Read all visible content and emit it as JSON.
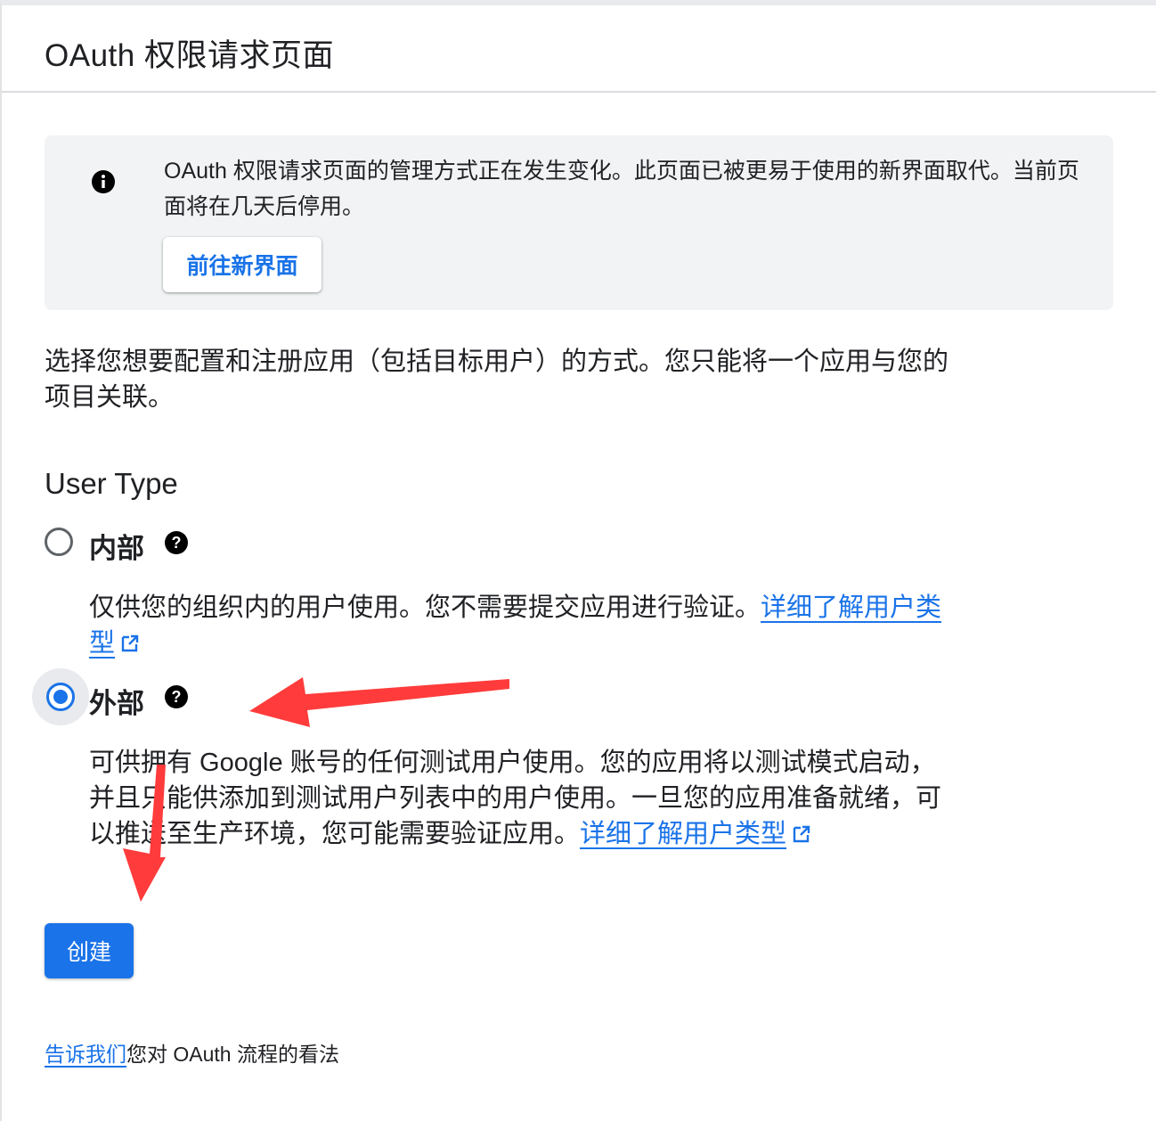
{
  "header": {
    "title": "OAuth 权限请求页面"
  },
  "notice": {
    "icon": "info-icon",
    "text": "OAuth 权限请求页面的管理方式正在发生变化。此页面已被更易于使用的新界面取代。当前页面将在几天后停用。",
    "button_label": "前往新界面"
  },
  "description": "选择您想要配置和注册应用（包括目标用户）的方式。您只能将一个应用与您的项目关联。",
  "user_type": {
    "title": "User Type",
    "internal": {
      "label": "内部",
      "selected": false,
      "description": "仅供您的组织内的用户使用。您不需要提交应用进行验证。",
      "link": "详细了解用户类型"
    },
    "external": {
      "label": "外部",
      "selected": true,
      "description": "可供拥有 Google 账号的任何测试用户使用。您的应用将以测试模式启动，并且只能供添加到测试用户列表中的用户使用。一旦您的应用准备就绪，可以推送至生产环境，您可能需要验证应用。",
      "link": "详细了解用户类型"
    }
  },
  "create_button": "创建",
  "feedback": {
    "link": "告诉我们",
    "text": "您对 OAuth 流程的看法"
  },
  "colors": {
    "accent": "#1a73e8",
    "annotation_arrow": "#ff3b3b",
    "notice_bg": "#f1f3f4"
  }
}
